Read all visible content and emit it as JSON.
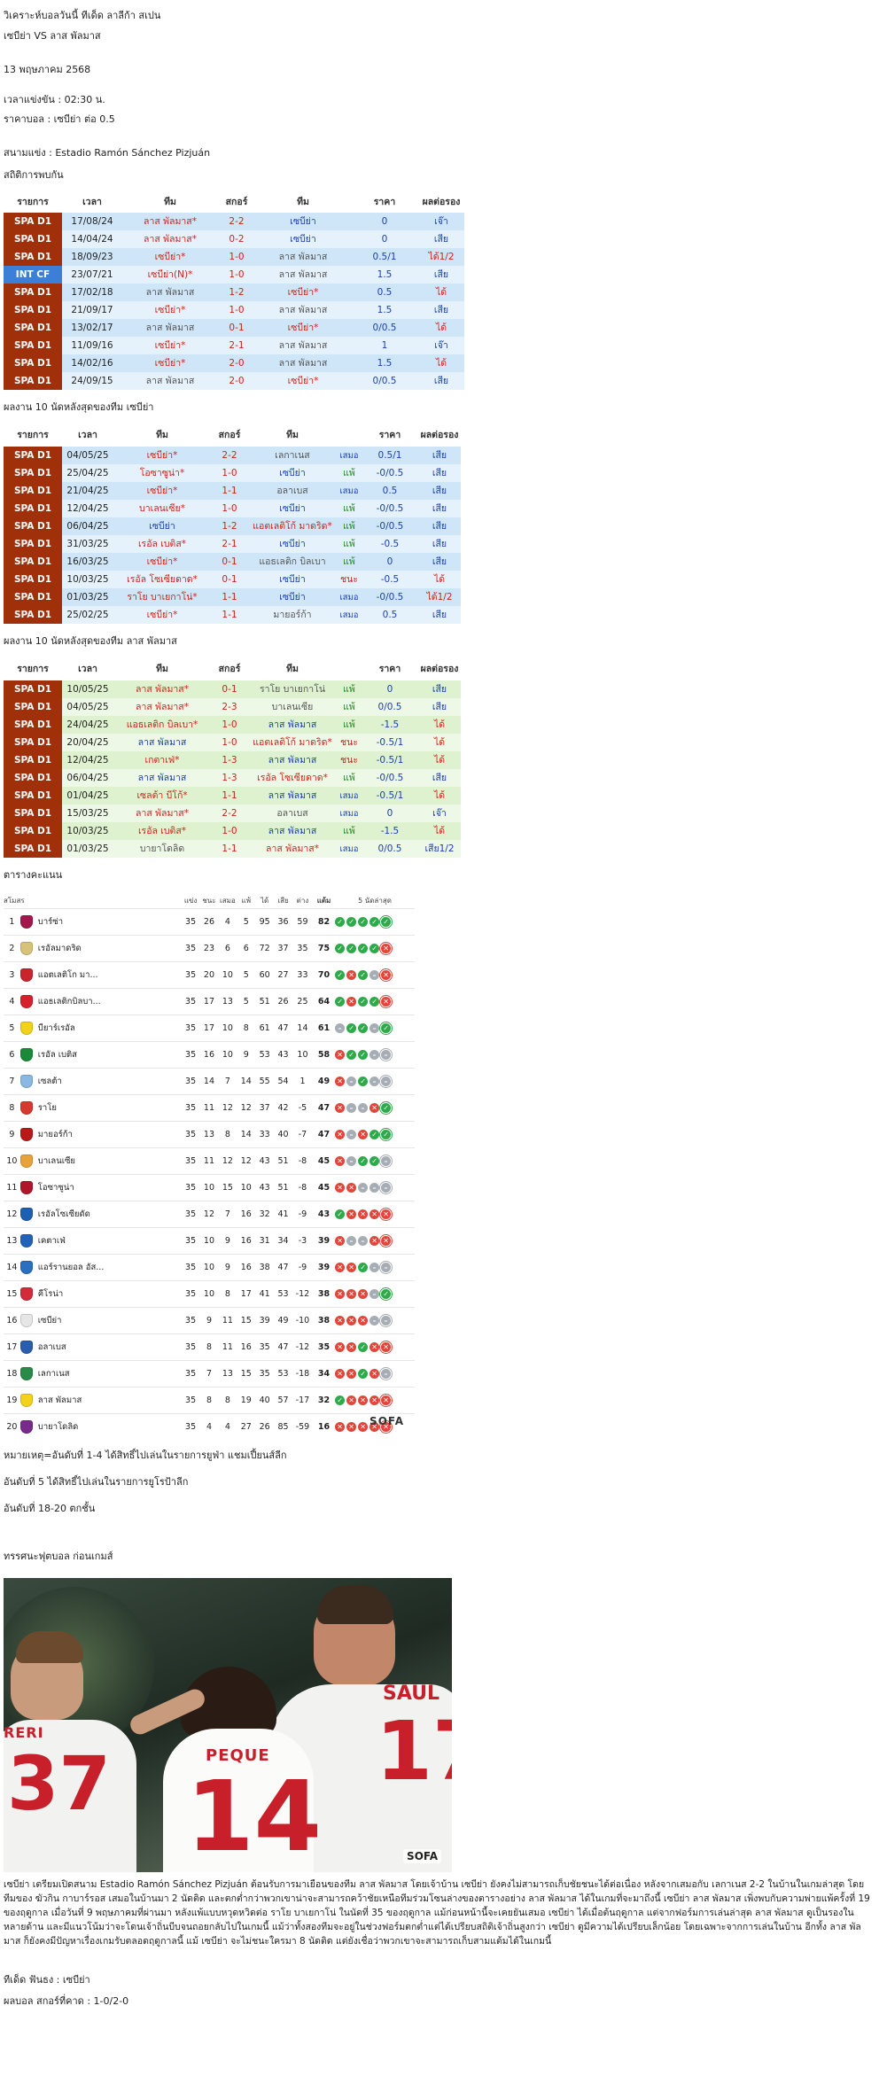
{
  "header": {
    "title": "วิเคราะห์บอลวันนี้ ทีเด็ด ลาลีก้า สเปน",
    "matchup": "เซบีย่า VS ลาส พัลมาส",
    "date": "13 พฤษภาคม 2568",
    "kickoff": "เวลาแข่งขัน : 02:30   น.",
    "odds": "ราคาบอล : เซบีย่า  ต่อ 0.5",
    "stadium": "สนามแข่ง : Estadio Ramón Sánchez Pizjuán"
  },
  "colors": {
    "blue": "#1a3fb0",
    "red": "#d0221b",
    "green": "#1f8b1f",
    "league_spa": "#a0300a",
    "league_int": "#3b7fd9"
  },
  "h2h": {
    "title": "สถิติการพบกัน",
    "columns": [
      "รายการ",
      "เวลา",
      "ทีม",
      "สกอร์",
      "ทีม",
      "ราคา",
      "ผลต่อรอง"
    ],
    "rows": [
      {
        "league": "SPA D1",
        "date": "17/08/24",
        "home": "ลาส พัลมาส",
        "home_star": "*",
        "score": "2-2",
        "away": "เซบีย่า",
        "away_star": "",
        "odds": "0",
        "result": "เจ๊า"
      },
      {
        "league": "SPA D1",
        "date": "14/04/24",
        "home": "ลาส พัลมาส",
        "home_star": "*",
        "score": "0-2",
        "away": "เซบีย่า",
        "away_star": "",
        "odds": "0",
        "result": "เสีย"
      },
      {
        "league": "SPA D1",
        "date": "18/09/23",
        "home": "เซบีย่า",
        "home_star": "*",
        "score": "1-0",
        "away": "ลาส พัลมาส",
        "away_star": "",
        "odds": "0.5/1",
        "result": "ได้1/2"
      },
      {
        "league": "INT CF",
        "date": "23/07/21",
        "home": "เซบีย่า(N)",
        "home_star": "*",
        "score": "1-0",
        "away": "ลาส พัลมาส",
        "away_star": "",
        "odds": "1.5",
        "result": "เสีย"
      },
      {
        "league": "SPA D1",
        "date": "17/02/18",
        "home": "ลาส พัลมาส",
        "home_star": "",
        "score": "1-2",
        "away": "เซบีย่า",
        "away_star": "*",
        "odds": "0.5",
        "result": "ได้"
      },
      {
        "league": "SPA D1",
        "date": "21/09/17",
        "home": "เซบีย่า",
        "home_star": "*",
        "score": "1-0",
        "away": "ลาส พัลมาส",
        "away_star": "",
        "odds": "1.5",
        "result": "เสีย"
      },
      {
        "league": "SPA D1",
        "date": "13/02/17",
        "home": "ลาส พัลมาส",
        "home_star": "",
        "score": "0-1",
        "away": "เซบีย่า",
        "away_star": "*",
        "odds": "0/0.5",
        "result": "ได้"
      },
      {
        "league": "SPA D1",
        "date": "11/09/16",
        "home": "เซบีย่า",
        "home_star": "*",
        "score": "2-1",
        "away": "ลาส พัลมาส",
        "away_star": "",
        "odds": "1",
        "result": "เจ๊า"
      },
      {
        "league": "SPA D1",
        "date": "14/02/16",
        "home": "เซบีย่า",
        "home_star": "*",
        "score": "2-0",
        "away": "ลาส พัลมาส",
        "away_star": "",
        "odds": "1.5",
        "result": "ได้"
      },
      {
        "league": "SPA D1",
        "date": "24/09/15",
        "home": "ลาส พัลมาส",
        "home_star": "",
        "score": "2-0",
        "away": "เซบีย่า",
        "away_star": "*",
        "odds": "0/0.5",
        "result": "เสีย"
      }
    ]
  },
  "last10_a": {
    "title": "ผลงาน 10 นัดหลังสุดของทีม เซบีย่า",
    "columns": [
      "รายการ",
      "เวลา",
      "ทีม",
      "สกอร์",
      "ทีม",
      "",
      "ราคา",
      "ผลต่อรอง"
    ],
    "rows": [
      {
        "league": "SPA D1",
        "date": "04/05/25",
        "home": "เซบีย่า",
        "home_star": "*",
        "score": "2-2",
        "away": "เลกาเนส",
        "away_star": "",
        "wl": "เสมอ",
        "odds": "0.5/1",
        "result": "เสีย"
      },
      {
        "league": "SPA D1",
        "date": "25/04/25",
        "home": "โอซาซูน่า",
        "home_star": "*",
        "score": "1-0",
        "away": "เซบีย่า",
        "away_star": "",
        "wl": "แพ้",
        "odds": "-0/0.5",
        "result": "เสีย"
      },
      {
        "league": "SPA D1",
        "date": "21/04/25",
        "home": "เซบีย่า",
        "home_star": "*",
        "score": "1-1",
        "away": "อลาเบส",
        "away_star": "",
        "wl": "เสมอ",
        "odds": "0.5",
        "result": "เสีย"
      },
      {
        "league": "SPA D1",
        "date": "12/04/25",
        "home": "บาเลนเซีย",
        "home_star": "*",
        "score": "1-0",
        "away": "เซบีย่า",
        "away_star": "",
        "wl": "แพ้",
        "odds": "-0/0.5",
        "result": "เสีย"
      },
      {
        "league": "SPA D1",
        "date": "06/04/25",
        "home": "เซบีย่า",
        "home_star": "",
        "score": "1-2",
        "away": "แอตเลติโก้ มาดริด",
        "away_star": "*",
        "wl": "แพ้",
        "odds": "-0/0.5",
        "result": "เสีย"
      },
      {
        "league": "SPA D1",
        "date": "31/03/25",
        "home": "เรอัล เบติส",
        "home_star": "*",
        "score": "2-1",
        "away": "เซบีย่า",
        "away_star": "",
        "wl": "แพ้",
        "odds": "-0.5",
        "result": "เสีย"
      },
      {
        "league": "SPA D1",
        "date": "16/03/25",
        "home": "เซบีย่า",
        "home_star": "*",
        "score": "0-1",
        "away": "แอธเลติก บิลเบา",
        "away_star": "",
        "wl": "แพ้",
        "odds": "0",
        "result": "เสีย"
      },
      {
        "league": "SPA D1",
        "date": "10/03/25",
        "home": "เรอัล โซเซียดาด",
        "home_star": "*",
        "score": "0-1",
        "away": "เซบีย่า",
        "away_star": "",
        "wl": "ชนะ",
        "odds": "-0.5",
        "result": "ได้"
      },
      {
        "league": "SPA D1",
        "date": "01/03/25",
        "home": "ราโย บาเยกาโน่",
        "home_star": "*",
        "score": "1-1",
        "away": "เซบีย่า",
        "away_star": "",
        "wl": "เสมอ",
        "odds": "-0/0.5",
        "result": "ได้1/2"
      },
      {
        "league": "SPA D1",
        "date": "25/02/25",
        "home": "เซบีย่า",
        "home_star": "*",
        "score": "1-1",
        "away": "มายอร์ก้า",
        "away_star": "",
        "wl": "เสมอ",
        "odds": "0.5",
        "result": "เสีย"
      }
    ]
  },
  "last10_b": {
    "title": "ผลงาน 10 นัดหลังสุดของทีม ลาส พัลมาส",
    "columns": [
      "รายการ",
      "เวลา",
      "ทีม",
      "สกอร์",
      "ทีม",
      "",
      "ราคา",
      "ผลต่อรอง"
    ],
    "rows": [
      {
        "league": "SPA D1",
        "date": "10/05/25",
        "home": "ลาส พัลมาส",
        "home_star": "*",
        "score": "0-1",
        "away": "ราโย บาเยกาโน่",
        "away_star": "",
        "wl": "แพ้",
        "odds": "0",
        "result": "เสีย"
      },
      {
        "league": "SPA D1",
        "date": "04/05/25",
        "home": "ลาส พัลมาส",
        "home_star": "*",
        "score": "2-3",
        "away": "บาเลนเซีย",
        "away_star": "",
        "wl": "แพ้",
        "odds": "0/0.5",
        "result": "เสีย"
      },
      {
        "league": "SPA D1",
        "date": "24/04/25",
        "home": "แอธเลติก บิลเบา",
        "home_star": "*",
        "score": "1-0",
        "away": "ลาส พัลมาส",
        "away_star": "",
        "wl": "แพ้",
        "odds": "-1.5",
        "result": "ได้"
      },
      {
        "league": "SPA D1",
        "date": "20/04/25",
        "home": "ลาส พัลมาส",
        "home_star": "",
        "score": "1-0",
        "away": "แอตเลติโก้ มาดริด",
        "away_star": "*",
        "wl": "ชนะ",
        "odds": "-0.5/1",
        "result": "ได้"
      },
      {
        "league": "SPA D1",
        "date": "12/04/25",
        "home": "เกตาเฟ่",
        "home_star": "*",
        "score": "1-3",
        "away": "ลาส พัลมาส",
        "away_star": "",
        "wl": "ชนะ",
        "odds": "-0.5/1",
        "result": "ได้"
      },
      {
        "league": "SPA D1",
        "date": "06/04/25",
        "home": "ลาส พัลมาส",
        "home_star": "",
        "score": "1-3",
        "away": "เรอัล โซเซียดาด",
        "away_star": "*",
        "wl": "แพ้",
        "odds": "-0/0.5",
        "result": "เสีย"
      },
      {
        "league": "SPA D1",
        "date": "01/04/25",
        "home": "เซลต้า บีโก้",
        "home_star": "*",
        "score": "1-1",
        "away": "ลาส พัลมาส",
        "away_star": "",
        "wl": "เสมอ",
        "odds": "-0.5/1",
        "result": "ได้"
      },
      {
        "league": "SPA D1",
        "date": "15/03/25",
        "home": "ลาส พัลมาส",
        "home_star": "*",
        "score": "2-2",
        "away": "อลาเบส",
        "away_star": "",
        "wl": "เสมอ",
        "odds": "0",
        "result": "เจ๊า"
      },
      {
        "league": "SPA D1",
        "date": "10/03/25",
        "home": "เรอัล เบติส",
        "home_star": "*",
        "score": "1-0",
        "away": "ลาส พัลมาส",
        "away_star": "",
        "wl": "แพ้",
        "odds": "-1.5",
        "result": "ได้"
      },
      {
        "league": "SPA D1",
        "date": "01/03/25",
        "home": "บายาโดลิด",
        "home_star": "",
        "score": "1-1",
        "away": "ลาส พัลมาส",
        "away_star": "*",
        "wl": "เสมอ",
        "odds": "0/0.5",
        "result": "เสีย1/2"
      }
    ]
  },
  "standings": {
    "title": "ตารางคะแนน",
    "columns": [
      "สโมสร",
      "แข่ง",
      "ชนะ",
      "เสมอ",
      "แพ้",
      "ได้",
      "เสีย",
      "ต่าง",
      "แต้ม",
      "5 นัดล่าสุด"
    ],
    "rows": [
      {
        "pos": "1",
        "team": "บาร์ซ่า",
        "crest": "#a3174d",
        "p": "35",
        "w": "26",
        "d": "4",
        "l": "5",
        "gf": "95",
        "ga": "36",
        "gd": "59",
        "pts": "82",
        "form": [
          "W",
          "W",
          "W",
          "W",
          "Wr"
        ]
      },
      {
        "pos": "2",
        "team": "เรอัลมาดริด",
        "crest": "#d7c27a",
        "p": "35",
        "w": "23",
        "d": "6",
        "l": "6",
        "gf": "72",
        "ga": "37",
        "gd": "35",
        "pts": "75",
        "form": [
          "W",
          "W",
          "W",
          "W",
          "Lr"
        ]
      },
      {
        "pos": "3",
        "team": "แอตเลติโก มา...",
        "crest": "#c8242d",
        "p": "35",
        "w": "20",
        "d": "10",
        "l": "5",
        "gf": "60",
        "ga": "27",
        "gd": "33",
        "pts": "70",
        "form": [
          "W",
          "L",
          "W",
          "D",
          "Lr"
        ]
      },
      {
        "pos": "4",
        "team": "แอธเลติกบิลบา...",
        "crest": "#d6202c",
        "p": "35",
        "w": "17",
        "d": "13",
        "l": "5",
        "gf": "51",
        "ga": "26",
        "gd": "25",
        "pts": "64",
        "form": [
          "W",
          "L",
          "W",
          "W",
          "Lr"
        ]
      },
      {
        "pos": "5",
        "team": "บียาร์เรอัล",
        "crest": "#f0d21a",
        "p": "35",
        "w": "17",
        "d": "10",
        "l": "8",
        "gf": "61",
        "ga": "47",
        "gd": "14",
        "pts": "61",
        "form": [
          "D",
          "W",
          "W",
          "D",
          "Wr"
        ]
      },
      {
        "pos": "6",
        "team": "เรอัล เบติส",
        "crest": "#1a8a3a",
        "p": "35",
        "w": "16",
        "d": "10",
        "l": "9",
        "gf": "53",
        "ga": "43",
        "gd": "10",
        "pts": "58",
        "form": [
          "L",
          "W",
          "W",
          "D",
          "Dr"
        ]
      },
      {
        "pos": "7",
        "team": "เซลต้า",
        "crest": "#8ab8e0",
        "p": "35",
        "w": "14",
        "d": "7",
        "l": "14",
        "gf": "55",
        "ga": "54",
        "gd": "1",
        "pts": "49",
        "form": [
          "L",
          "D",
          "W",
          "D",
          "Dr"
        ]
      },
      {
        "pos": "8",
        "team": "ราโย",
        "crest": "#d63a2e",
        "p": "35",
        "w": "11",
        "d": "12",
        "l": "12",
        "gf": "37",
        "ga": "42",
        "gd": "-5",
        "pts": "47",
        "form": [
          "L",
          "D",
          "D",
          "L",
          "Wr"
        ]
      },
      {
        "pos": "9",
        "team": "มายอร์ก้า",
        "crest": "#b81a1a",
        "p": "35",
        "w": "13",
        "d": "8",
        "l": "14",
        "gf": "33",
        "ga": "40",
        "gd": "-7",
        "pts": "47",
        "form": [
          "L",
          "D",
          "L",
          "W",
          "Wr"
        ]
      },
      {
        "pos": "10",
        "team": "บาเลนเซีย",
        "crest": "#e8a23a",
        "p": "35",
        "w": "11",
        "d": "12",
        "l": "12",
        "gf": "43",
        "ga": "51",
        "gd": "-8",
        "pts": "45",
        "form": [
          "L",
          "D",
          "W",
          "W",
          "Dr"
        ]
      },
      {
        "pos": "11",
        "team": "โอซาซูน่า",
        "crest": "#b0162a",
        "p": "35",
        "w": "10",
        "d": "15",
        "l": "10",
        "gf": "43",
        "ga": "51",
        "gd": "-8",
        "pts": "45",
        "form": [
          "L",
          "L",
          "D",
          "D",
          "Dr"
        ]
      },
      {
        "pos": "12",
        "team": "เรอัลโซเซียดัด",
        "crest": "#1f5fb2",
        "p": "35",
        "w": "12",
        "d": "7",
        "l": "16",
        "gf": "32",
        "ga": "41",
        "gd": "-9",
        "pts": "43",
        "form": [
          "W",
          "L",
          "L",
          "L",
          "Lr"
        ]
      },
      {
        "pos": "13",
        "team": "เคตาเฟ่",
        "crest": "#2462b8",
        "p": "35",
        "w": "10",
        "d": "9",
        "l": "16",
        "gf": "31",
        "ga": "34",
        "gd": "-3",
        "pts": "39",
        "form": [
          "L",
          "D",
          "D",
          "L",
          "Lr"
        ]
      },
      {
        "pos": "14",
        "team": "แอร์รานยอล อัส...",
        "crest": "#2a6fc0",
        "p": "35",
        "w": "10",
        "d": "9",
        "l": "16",
        "gf": "38",
        "ga": "47",
        "gd": "-9",
        "pts": "39",
        "form": [
          "L",
          "L",
          "W",
          "D",
          "Dr"
        ]
      },
      {
        "pos": "15",
        "team": "คีโรน่า",
        "crest": "#d22c3a",
        "p": "35",
        "w": "10",
        "d": "8",
        "l": "17",
        "gf": "41",
        "ga": "53",
        "gd": "-12",
        "pts": "38",
        "form": [
          "L",
          "L",
          "L",
          "D",
          "Wr"
        ]
      },
      {
        "pos": "16",
        "team": "เซบีย่า",
        "crest": "#e6e6e6",
        "p": "35",
        "w": "9",
        "d": "11",
        "l": "15",
        "gf": "39",
        "ga": "49",
        "gd": "-10",
        "pts": "38",
        "form": [
          "L",
          "L",
          "L",
          "D",
          "Dr"
        ]
      },
      {
        "pos": "17",
        "team": "อลาเบส",
        "crest": "#2a5cb0",
        "p": "35",
        "w": "8",
        "d": "11",
        "l": "16",
        "gf": "35",
        "ga": "47",
        "gd": "-12",
        "pts": "35",
        "form": [
          "L",
          "L",
          "W",
          "L",
          "Lr"
        ]
      },
      {
        "pos": "18",
        "team": "เลกาเนส",
        "crest": "#2a8a4a",
        "p": "35",
        "w": "7",
        "d": "13",
        "l": "15",
        "gf": "35",
        "ga": "53",
        "gd": "-18",
        "pts": "34",
        "form": [
          "L",
          "L",
          "W",
          "L",
          "Dr"
        ]
      },
      {
        "pos": "19",
        "team": "ลาส พัลมาส",
        "crest": "#f2d21a",
        "p": "35",
        "w": "8",
        "d": "8",
        "l": "19",
        "gf": "40",
        "ga": "57",
        "gd": "-17",
        "pts": "32",
        "form": [
          "W",
          "L",
          "L",
          "L",
          "Lr"
        ]
      },
      {
        "pos": "20",
        "team": "บายาโดลิด",
        "crest": "#7a2a8a",
        "p": "35",
        "w": "4",
        "d": "4",
        "l": "27",
        "gf": "26",
        "ga": "85",
        "gd": "-59",
        "pts": "16",
        "form": [
          "L",
          "L",
          "L",
          "L",
          "Lr"
        ]
      }
    ],
    "watermark": "SOFA"
  },
  "notes": [
    "หมายเหตุ=อันดับที่ 1-4 ได้สิทธิ์ไปเล่นในรายการยูฟ่า แชมเปี้ยนส์ลีก",
    "อันดับที่ 5 ได้สิทธิ์ไปเล่นในรายการยูโรป้าลีก",
    "อันดับที่ 18-20 ตกชั้น"
  ],
  "preview": {
    "title": "ทรรศนะฟุตบอล ก่อนเกมส์",
    "photo": {
      "left_number": "37",
      "center_name": "PEQUE",
      "center_number": "14",
      "right_name": "SAUL",
      "right_number": "17",
      "left_name": "RERI",
      "watermark": "SOFA"
    },
    "paragraph": "เซบีย่า เตรียมเปิดสนาม Estadio Ramón Sánchez Pizjuán ต้อนรับการมาเยือนของทีม ลาส พัลมาส โดยเจ้าบ้าน เซบีย่า ยังคงไม่สามารถเก็บชัยชนะได้ต่อเนื่อง หลังจากเสมอกับ เลกาเนส 2-2 ในบ้านในเกมล่าสุด โดยทีมของ ฆัวกิน กาบาร์รอส เสมอในบ้านมา 2 นัดติด และตกต่ำกว่าพวกเขาน่าจะสามารถคว้าชัยเหนือทีมร่วมโซนล่างของตารางอย่าง ลาส พัลมาส ได้ในเกมที่จะมาถึงนี้ เซบีย่า ลาส พัลมาส เพิ่งพบกับความพ่ายแพ้ครั้งที่ 19 ของฤดูกาล เมื่อวันที่ 9 พฤษภาคมที่ผ่านมา หลังแพ้แบบหวุดหวิดต่อ ราโย บาเยกาโน่ ในนัดที่ 35 ของฤดูกาล แม้ก่อนหน้านี้จะเคยยันเสมอ เซบีย่า ได้เมื่อต้นฤดูกาล แต่จากฟอร์มการเล่นล่าสุด ลาส พัลมาส ดูเป็นรองในหลายด้าน และมีแนวโน้มว่าจะโดนเจ้าถิ่นบีบจนถอยกลับไปในเกมนี้ แม้ว่าทั้งสองทีมจะอยู่ในช่วงฟอร์มตกต่ำแต่ได้เปรียบสถิติเจ้าถิ่นสูงกว่า เซบีย่า ดูมีความได้เปรียบเล็กน้อย โดยเฉพาะจากการเล่นในบ้าน อีกทั้ง ลาส พัลมาส ก็ยังคงมีปัญหาเรื่องเกมรับตลอดฤดูกาลนี้ แม้ เซบีย่า จะไม่ชนะใครมา 8 นัดติด แต่ยังเชื่อว่าพวกเขาจะสามารถเก็บสามแต้มได้ในเกมนี้"
  },
  "footer": {
    "pick": "ทีเด็ด ฟันธง : เซบีย่า",
    "predict": "ผลบอล สกอร์ที่คาด  : 1-0/2-0"
  }
}
